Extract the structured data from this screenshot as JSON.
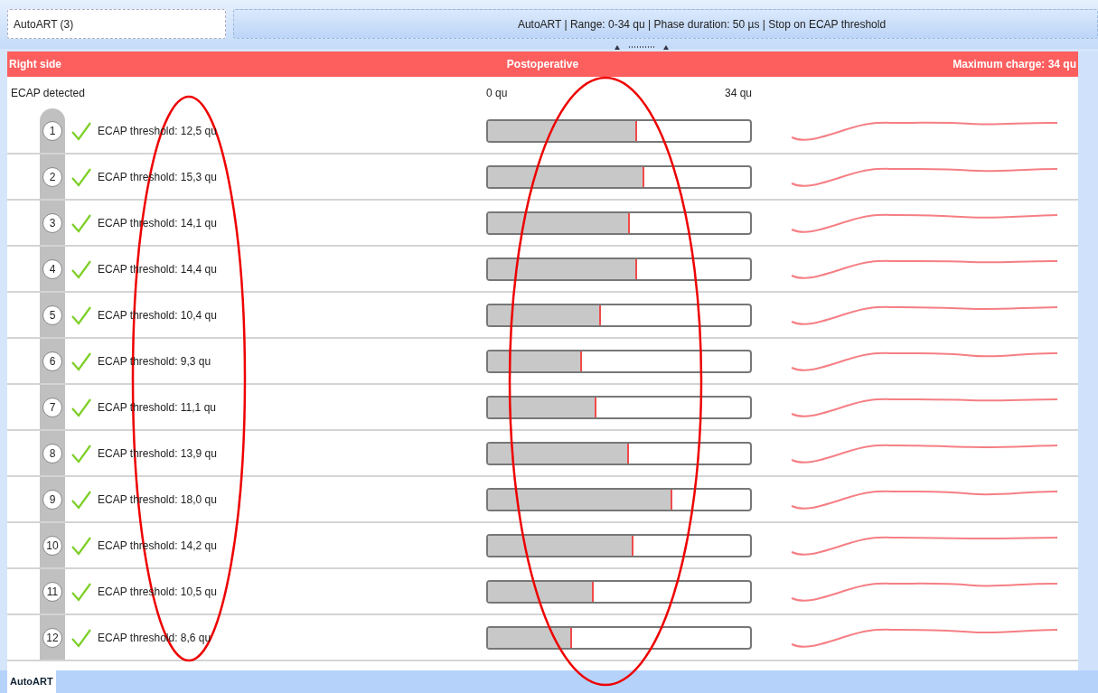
{
  "tab_field": {
    "value": "AutoART (3)"
  },
  "settings_bar": {
    "text": "AutoART | Range: 0-34 qu | Phase duration: 50 µs | Stop on ECAP threshold"
  },
  "header": {
    "side": "Right side",
    "condition": "Postoperative",
    "max_charge": "Maximum charge: 34 qu"
  },
  "status_label": "ECAP detected",
  "scale": {
    "min": "0 qu",
    "max": "34 qu"
  },
  "electrodes": [
    {
      "number": "1",
      "detected": true,
      "threshold": "ECAP threshold: 12,5 qu",
      "level": 0.57
    },
    {
      "number": "2",
      "detected": true,
      "threshold": "ECAP threshold: 15,3 qu",
      "level": 0.595
    },
    {
      "number": "3",
      "detected": true,
      "threshold": "ECAP threshold: 14,1 qu",
      "level": 0.54
    },
    {
      "number": "4",
      "detected": true,
      "threshold": "ECAP threshold: 14,4 qu",
      "level": 0.568
    },
    {
      "number": "5",
      "detected": true,
      "threshold": "ECAP threshold: 10,4 qu",
      "level": 0.432
    },
    {
      "number": "6",
      "detected": true,
      "threshold": "ECAP threshold: 9,3 qu",
      "level": 0.36
    },
    {
      "number": "7",
      "detected": true,
      "threshold": "ECAP threshold: 11,1 qu",
      "level": 0.415
    },
    {
      "number": "8",
      "detected": true,
      "threshold": "ECAP threshold: 13,9 qu",
      "level": 0.537
    },
    {
      "number": "9",
      "detected": true,
      "threshold": "ECAP threshold: 18,0 qu",
      "level": 0.704
    },
    {
      "number": "10",
      "detected": true,
      "threshold": "ECAP threshold: 14,2 qu",
      "level": 0.554
    },
    {
      "number": "11",
      "detected": true,
      "threshold": "ECAP threshold: 10,5 qu",
      "level": 0.405
    },
    {
      "number": "12",
      "detected": true,
      "threshold": "ECAP threshold: 8,6 qu",
      "level": 0.32
    }
  ],
  "bottom_tabs": [
    {
      "label": "AutoART",
      "selected": true
    }
  ]
}
